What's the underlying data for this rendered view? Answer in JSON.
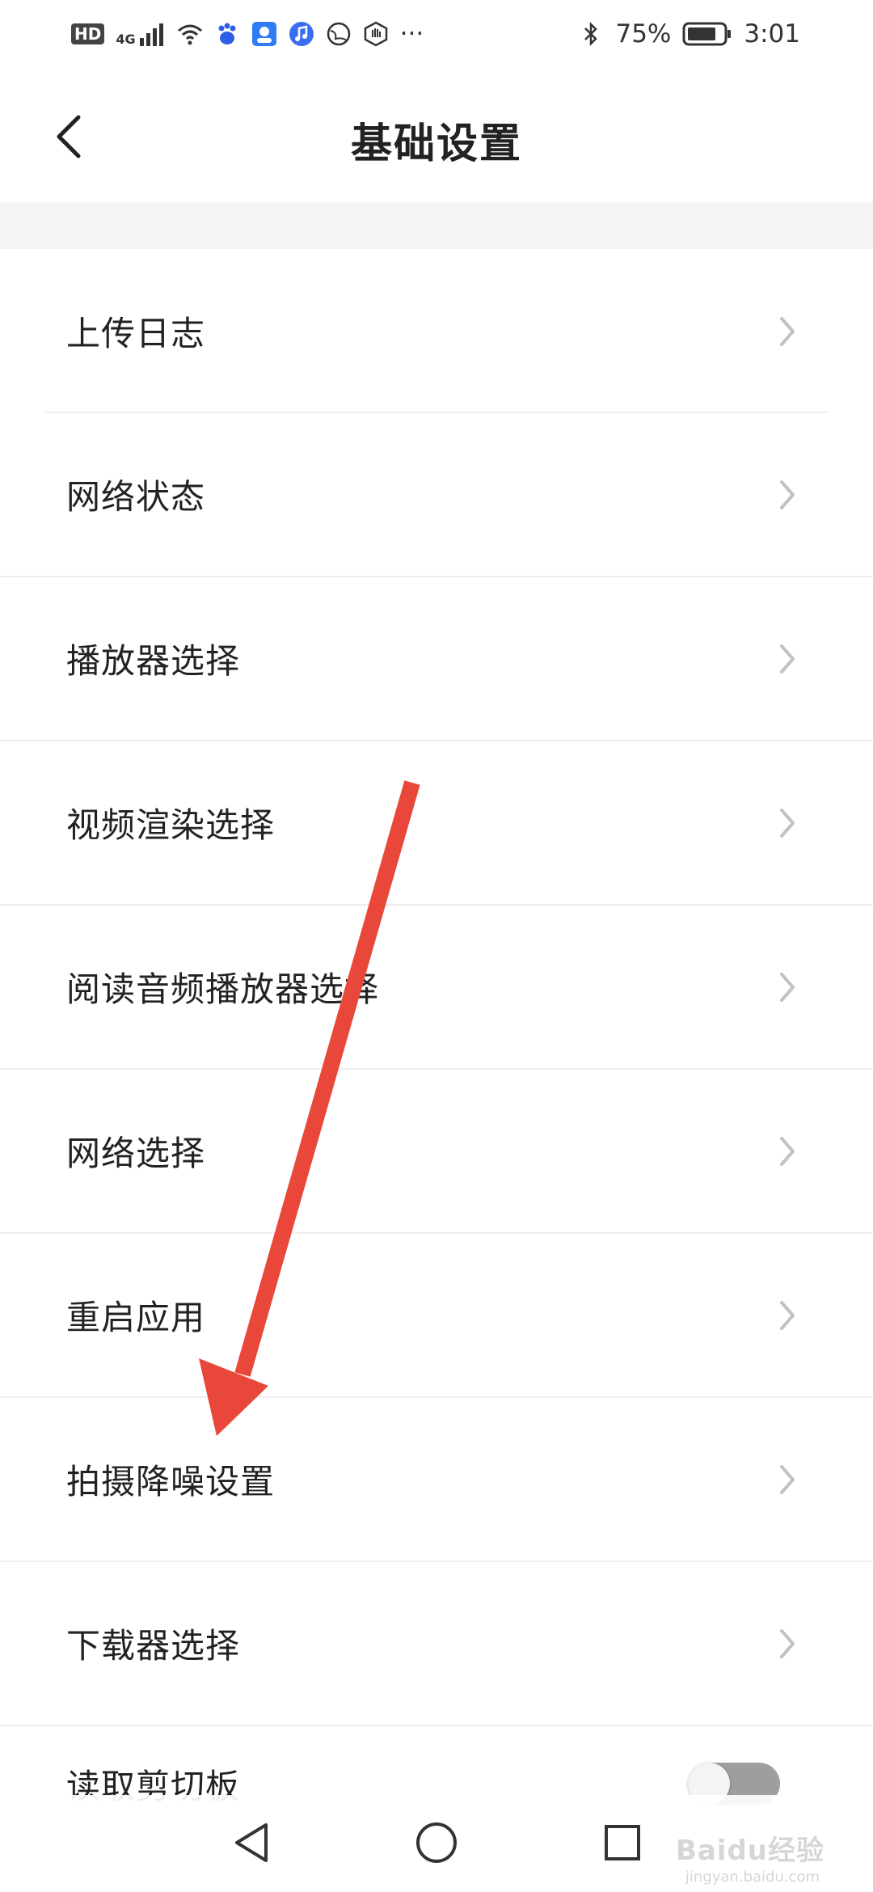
{
  "status_bar": {
    "hd_label": "HD",
    "network_label": "4G",
    "battery": "75%",
    "time": "3:01",
    "more": "···",
    "icons": [
      "hd-icon",
      "signal-icon",
      "wifi-icon",
      "baidu-paw-icon",
      "contact-icon",
      "music-icon",
      "browser-icon",
      "hand-icon",
      "bluetooth-icon",
      "battery-icon"
    ]
  },
  "header": {
    "title": "基础设置",
    "back_icon": "chevron-left-icon"
  },
  "settings": {
    "items": [
      {
        "label": "上传日志"
      },
      {
        "label": "网络状态"
      },
      {
        "label": "播放器选择"
      },
      {
        "label": "视频渲染选择"
      },
      {
        "label": "阅读音频播放器选择"
      },
      {
        "label": "网络选择"
      },
      {
        "label": "重启应用"
      },
      {
        "label": "拍摄降噪设置"
      },
      {
        "label": "下载器选择"
      }
    ],
    "last_item": {
      "label": "读取剪切板",
      "toggle_on": false
    }
  },
  "nav_bar": {
    "icons": [
      "back-triangle-icon",
      "home-circle-icon",
      "recents-square-icon"
    ]
  },
  "annotation": {
    "color": "#e8473a"
  },
  "watermark": {
    "text": "Baidu经验",
    "sub": "jingyan.baidu.com"
  }
}
